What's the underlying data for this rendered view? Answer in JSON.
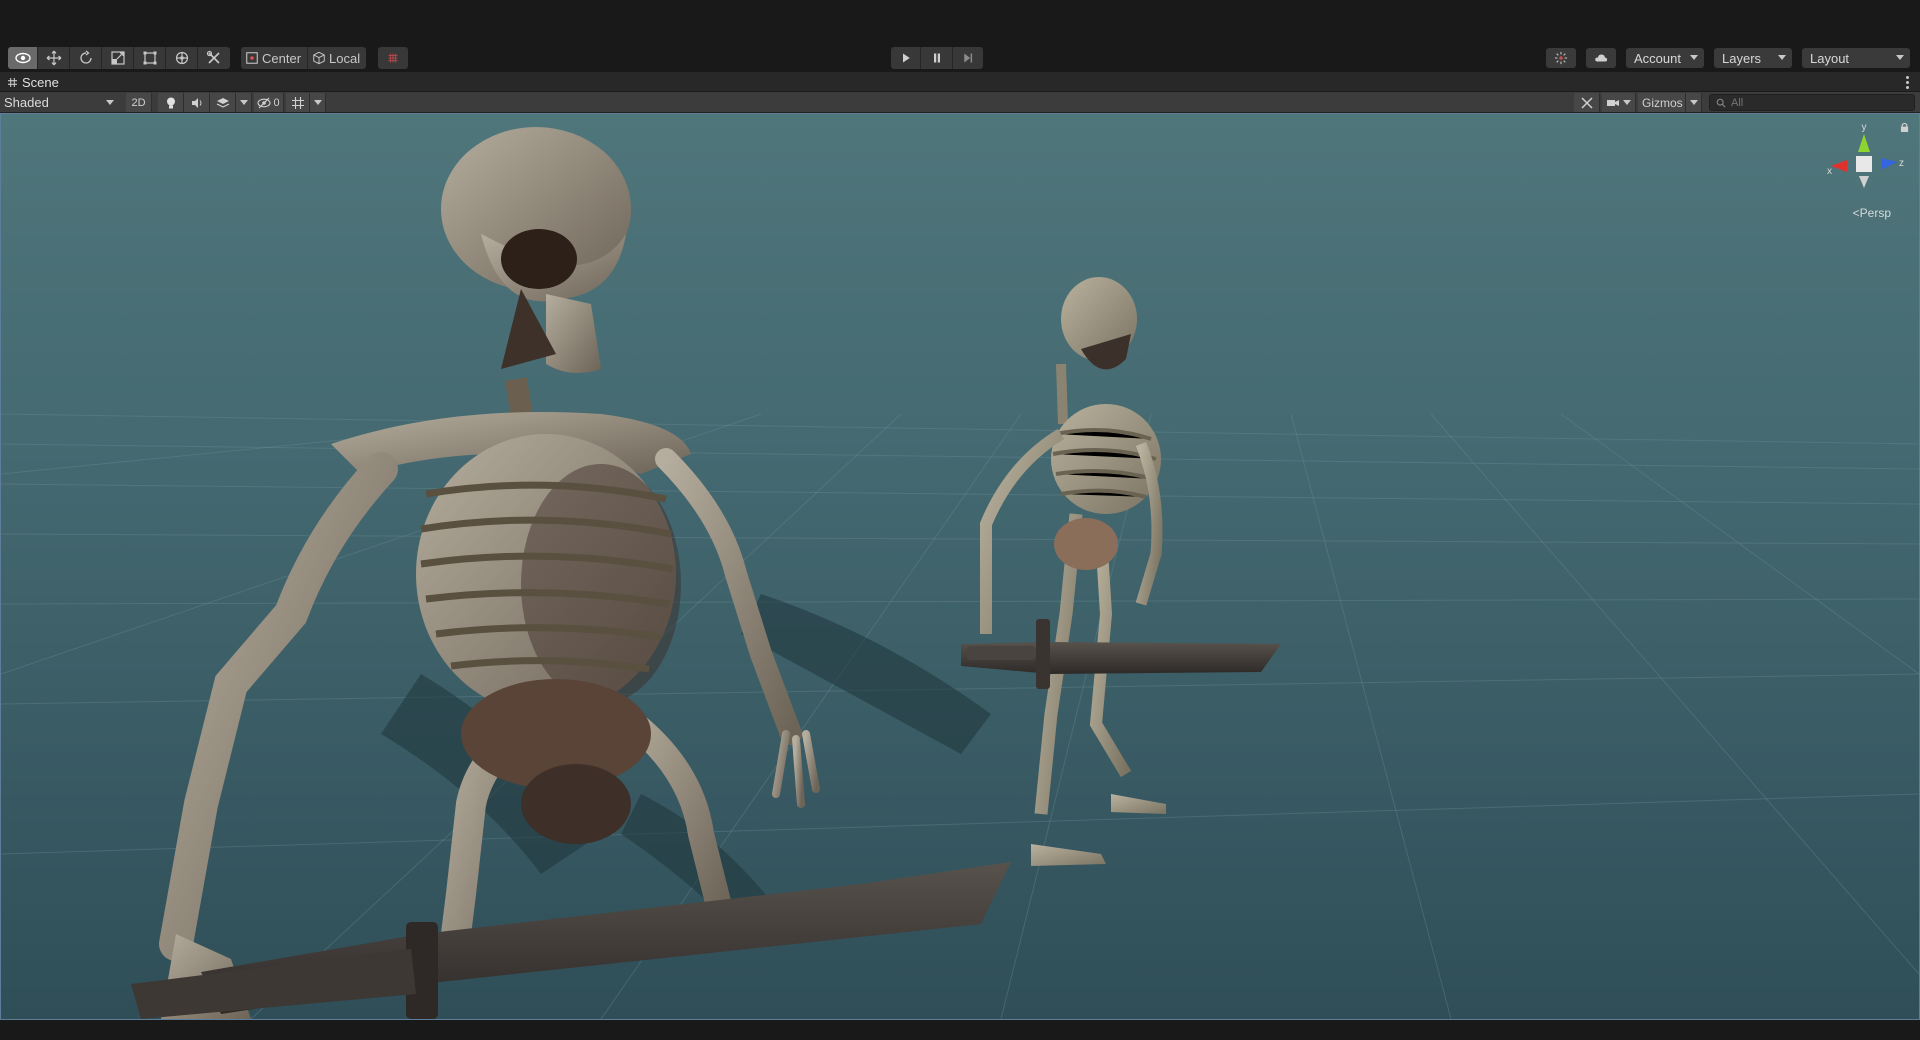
{
  "toolbar": {
    "pivot_mode": "Center",
    "pivot_rotation": "Local",
    "account_label": "Account",
    "layers_label": "Layers",
    "layout_label": "Layout",
    "tools": [
      "view-tool",
      "move-tool",
      "rotate-tool",
      "scale-tool",
      "rect-tool",
      "transform-tool",
      "custom-tool"
    ],
    "active_tool": "view-tool"
  },
  "scene_tab": {
    "title": "Scene"
  },
  "scene_toolbar": {
    "draw_mode": "Shaded",
    "toggle_2d": "2D",
    "hidden_count": "0",
    "gizmos_label": "Gizmos",
    "search_placeholder": "All"
  },
  "viewport": {
    "projection_label": "Persp",
    "axis_labels": {
      "y": "y",
      "x": "x",
      "z": "z"
    }
  },
  "colors": {
    "background": "#191919",
    "panel": "#3c3c3c",
    "sky_top": "#4d7378",
    "ground": "#365660",
    "axis_x": "#e0322c",
    "axis_y": "#8ed430",
    "axis_z": "#3366e0"
  }
}
